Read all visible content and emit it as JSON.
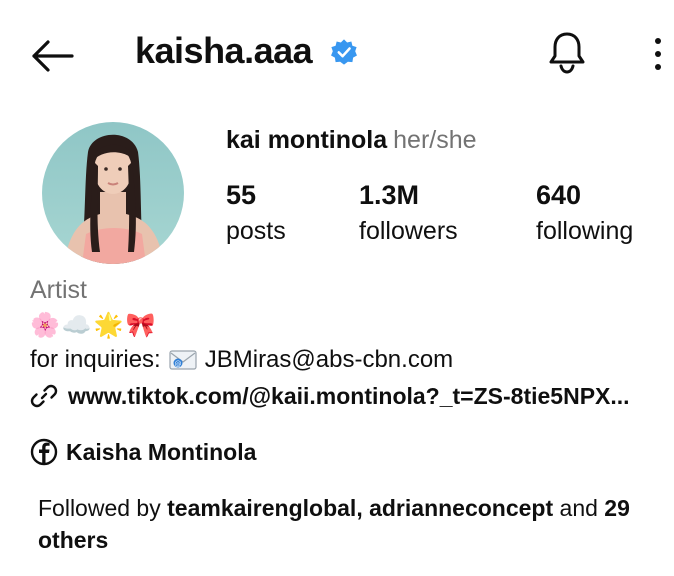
{
  "header": {
    "username": "kaisha.aaa",
    "verified_color": "#3897f0"
  },
  "profile": {
    "full_name": "kai montinola",
    "pronouns": "her/she"
  },
  "stats": [
    {
      "value": "55",
      "label": "posts"
    },
    {
      "value": "1.3M",
      "label": "followers"
    },
    {
      "value": "640",
      "label": "following"
    }
  ],
  "bio": {
    "category": "Artist",
    "emojis": [
      "🌸",
      "☁️",
      "🌟",
      "🎀"
    ],
    "inquiry_prefix": "for inquiries:",
    "inquiry_email": "JBMiras@abs-cbn.com",
    "link": "www.tiktok.com/@kaii.montinola?_t=ZS-8tie5NPX..."
  },
  "facebook": {
    "name": "Kaisha Montinola"
  },
  "followed_by": {
    "prefix": "Followed by ",
    "user1": "teamkairenglobal",
    "sep": ", ",
    "user2": "adrianneconcept",
    "and_text": " and ",
    "count": "29",
    "others": "others"
  },
  "icons": {
    "back": "arrow-left-icon",
    "verified": "verified-badge-icon",
    "bell": "bell-icon",
    "more": "more-vertical-icon",
    "link": "link-icon",
    "facebook": "facebook-icon",
    "mail": "envelope-icon"
  }
}
